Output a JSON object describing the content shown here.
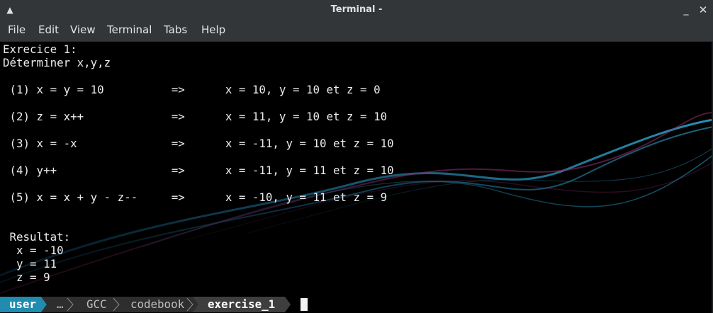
{
  "window": {
    "title": "Terminal -"
  },
  "menu": [
    "File",
    "Edit",
    "View",
    "Terminal",
    "Tabs",
    "Help"
  ],
  "terminal": {
    "lines": [
      "Exrecice 1:",
      "Déterminer x,y,z",
      "",
      " (1) x = y = 10          =>      x = 10, y = 10 et z = 0",
      "",
      " (2) z = x++             =>      x = 11, y = 10 et z = 10",
      "",
      " (3) x = -x              =>      x = -11, y = 10 et z = 10",
      "",
      " (4) y++                 =>      x = -11, y = 11 et z = 10",
      "",
      " (5) x = x + y - z--     =>      x = -10, y = 11 et z = 9",
      "",
      "",
      " Resultat:",
      "  x = -10",
      "  y = 11",
      "  z = 9"
    ]
  },
  "prompt": {
    "user": "user",
    "ellipsis": "…",
    "dir1": "GCC",
    "dir2": "codebook",
    "dir3": "exercise_1"
  },
  "colors": {
    "titlebar": "#323639",
    "prompt_user_bg": "#1f8cb0",
    "prompt_path_bg": "#2e2e2e",
    "prompt_current_bg": "#3e3e3e"
  }
}
